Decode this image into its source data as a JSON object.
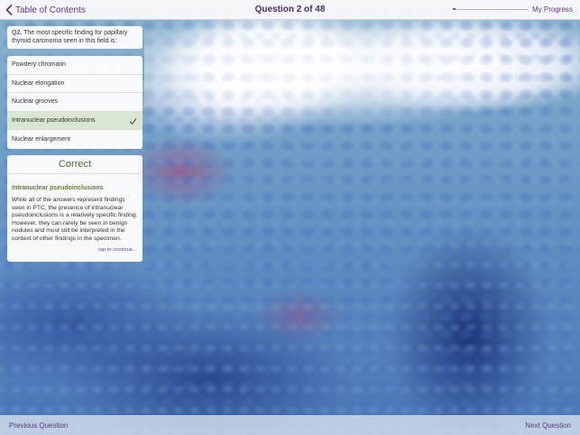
{
  "header": {
    "back_label": "Table of Contents",
    "title": "Question 2 of 48",
    "progress_label": "My Progress",
    "progress_fraction": 0.04
  },
  "question": {
    "number": "Q2.",
    "text": "The most specific finding for papillary thyroid carcinoma seen in this field is:"
  },
  "answers": [
    {
      "label": "Powdery chromatin",
      "selected": false
    },
    {
      "label": "Nuclear elongation",
      "selected": false
    },
    {
      "label": "Nuclear grooves",
      "selected": false
    },
    {
      "label": "Intranuclear pseudoinclusions",
      "selected": true
    },
    {
      "label": "Nuclear enlargement",
      "selected": false
    }
  ],
  "feedback": {
    "status": "Correct",
    "answer": "Intranuclear pseudoinclusions",
    "explanation": "While all of the answers represent findings seen in PTC, the presence of intranuclear pseudoinclusions is a relatively specific finding.  However, they can rarely be seen in benign nodules and must still be interpreted in the context of other findings in the specimen.",
    "continue_label": "tap to continue..."
  },
  "footer": {
    "previous_label": "Previous Question",
    "next_label": "Next Question"
  },
  "colors": {
    "accent": "#5c3b7e",
    "correct": "#4b6a2e",
    "selected_bg": "#d9e6d2"
  }
}
